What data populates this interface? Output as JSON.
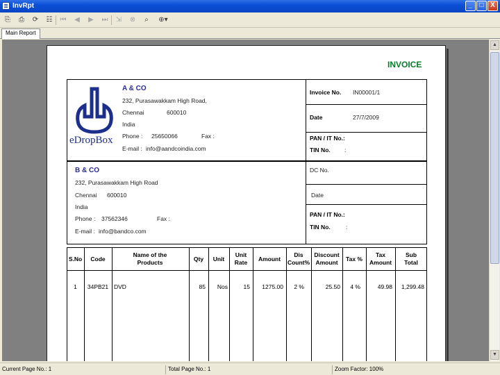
{
  "window": {
    "title": "InvRpt",
    "minimize": "_",
    "maximize": "□",
    "close": "X"
  },
  "toolbar": {
    "icons": [
      "export-icon",
      "print-icon",
      "refresh-icon",
      "tree-icon",
      "first-page-icon",
      "prev-page-icon",
      "next-page-icon",
      "last-page-icon",
      "goto-icon",
      "stop-icon",
      "find-icon",
      "zoom-icon"
    ]
  },
  "tabs": [
    "Main Report"
  ],
  "report": {
    "heading": "INVOICE",
    "logo_text": "eDropBox",
    "seller": {
      "name": "A & CO",
      "line1": "232, Purasawakkam High Road,",
      "city_label": "Chennai",
      "pincode": "600010",
      "country": "India",
      "phone_label": "Phone :",
      "phone": "25650066",
      "fax_label": "Fax :",
      "email_label": "E-mail :",
      "email": "info@aandcoindia.com"
    },
    "invoice_no_label": "Invoice No.",
    "invoice_no": "IN00001/1",
    "date_label": "Date",
    "date": "27/7/2009",
    "pan_label": "PAN / IT No.:",
    "tin_label": "TIN No.",
    "tin_colon": ":",
    "buyer": {
      "name": "B & CO",
      "line1": "232, Purasawakkam High Road",
      "city": "Chennai",
      "pincode": "600010",
      "country": "India",
      "phone_label": "Phone :",
      "phone": "37562346",
      "fax_label": "Fax :",
      "email_label": "E-mail :",
      "email": "info@bandco.com"
    },
    "dc_no_label": "DC No.",
    "buyer_date_label": "Date",
    "buyer_pan_label": "PAN / IT No.:",
    "buyer_tin_label": "TIN No.",
    "buyer_tin_colon": ":",
    "table": {
      "headers": [
        "S.No",
        "Code",
        "Name of the Products",
        "Qty",
        "Unit",
        "Unit Rate",
        "Amount",
        "Dis Count%",
        "Discount Amount",
        "Tax %",
        "Tax Amount",
        "Sub Total"
      ],
      "rows": [
        [
          "1",
          "34PB21",
          "DVD",
          "85",
          "Nos",
          "15",
          "1275.00",
          "2 %",
          "25.50",
          "4 %",
          "49.98",
          "1,299.48"
        ]
      ]
    }
  },
  "status": {
    "current_page": "Current Page No.: 1",
    "total_page": "Total Page No.: 1",
    "zoom": "Zoom Factor: 100%"
  }
}
